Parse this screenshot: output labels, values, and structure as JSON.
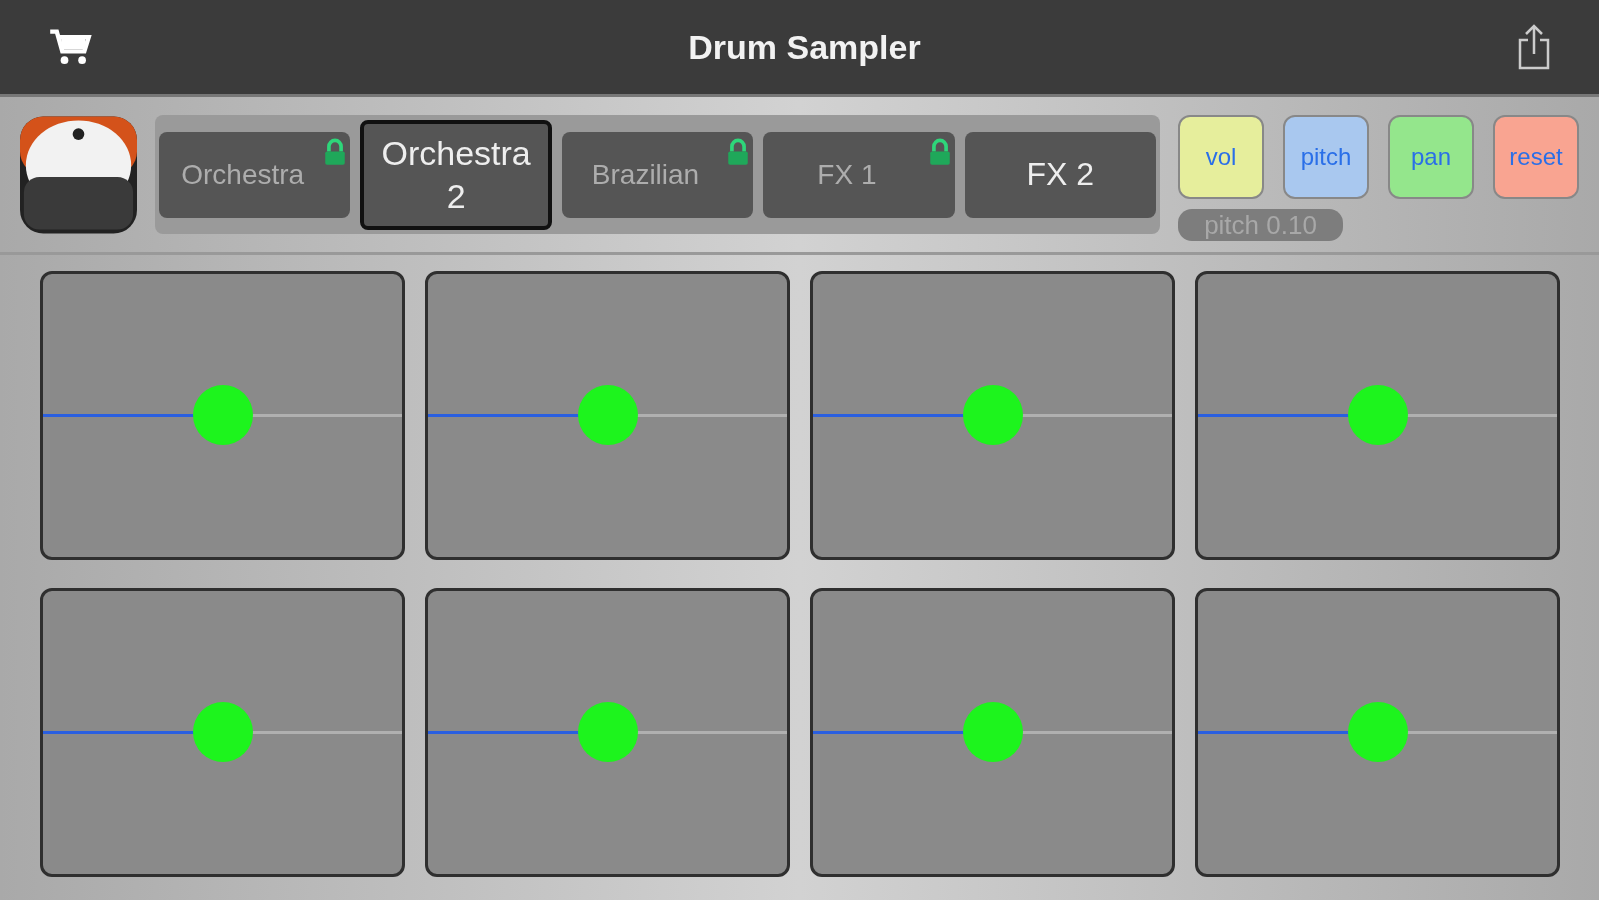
{
  "header": {
    "title": "Drum Sampler"
  },
  "kits": [
    {
      "label": "Orchestra",
      "selected": false,
      "locked": true
    },
    {
      "label": "Orchestra 2",
      "selected": true,
      "locked": false
    },
    {
      "label": "Brazilian",
      "selected": false,
      "locked": true
    },
    {
      "label": "FX 1",
      "selected": false,
      "locked": true
    },
    {
      "label": "FX 2",
      "selected": false,
      "locked": false
    }
  ],
  "modes": [
    {
      "label": "vol",
      "color": "#e6ee9c"
    },
    {
      "label": "pitch",
      "color": "#a9c8ef"
    },
    {
      "label": "pan",
      "color": "#94e68c"
    },
    {
      "label": "reset",
      "color": "#f9a491"
    }
  ],
  "readout": "pitch 0.10",
  "pads": [
    {
      "level": 0.5
    },
    {
      "level": 0.5
    },
    {
      "level": 0.5
    },
    {
      "level": 0.5
    },
    {
      "level": 0.5
    },
    {
      "level": 0.5
    },
    {
      "level": 0.5
    },
    {
      "level": 0.5
    }
  ]
}
